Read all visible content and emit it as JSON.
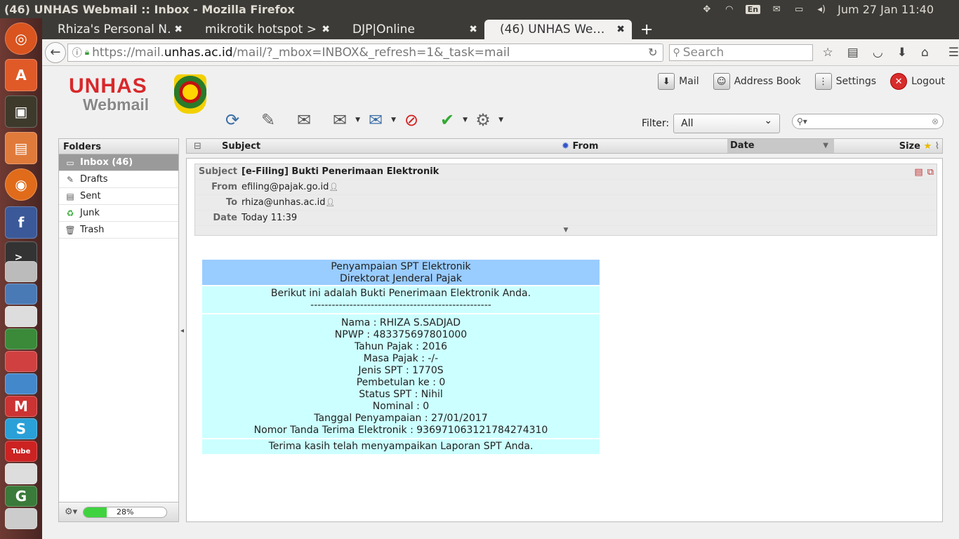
{
  "system": {
    "window_title": "(46) UNHAS Webmail :: Inbox - Mozilla Firefox",
    "keyboard_layout": "En",
    "clock": "Jum 27 Jan 11:40"
  },
  "tabs": [
    {
      "label": "Rhiza's Personal N…",
      "active": false
    },
    {
      "label": "mikrotik hotspot > …",
      "active": false
    },
    {
      "label": "DJP|Online",
      "active": false
    },
    {
      "label": "(46) UNHAS We…",
      "active": true
    }
  ],
  "browser": {
    "url_prefix": "https://mail.",
    "url_host": "unhas.ac.id",
    "url_rest": "/mail/?_mbox=INBOX&_refresh=1&_task=mail",
    "search_placeholder": "Search"
  },
  "logo": {
    "line1": "UNHAS",
    "line2": "Webmail"
  },
  "topnav": [
    {
      "label": "Mail",
      "icon": "mail-icon"
    },
    {
      "label": "Address Book",
      "icon": "address-book-icon"
    },
    {
      "label": "Settings",
      "icon": "settings-icon"
    },
    {
      "label": "Logout",
      "icon": "logout-icon"
    }
  ],
  "toolbar": [
    "refresh",
    "compose",
    "reply",
    "reply-all",
    "forward",
    "delete",
    "mark",
    "more"
  ],
  "filter": {
    "label": "Filter:",
    "value": "All"
  },
  "folders": {
    "header": "Folders",
    "items": [
      {
        "label": "Inbox (46)",
        "icon": "inbox-icon",
        "selected": true
      },
      {
        "label": "Drafts",
        "icon": "pencil-icon",
        "selected": false
      },
      {
        "label": "Sent",
        "icon": "sent-icon",
        "selected": false
      },
      {
        "label": "Junk",
        "icon": "junk-icon",
        "selected": false
      },
      {
        "label": "Trash",
        "icon": "trash-icon",
        "selected": false
      }
    ],
    "quota_text": "28%",
    "quota_value": 0.28
  },
  "list_header": {
    "subject": "Subject",
    "from": "From",
    "date": "Date",
    "size": "Size"
  },
  "message": {
    "labels": {
      "subject": "Subject",
      "from": "From",
      "to": "To",
      "date": "Date"
    },
    "subject": "[e-Filing] Bukti Penerimaan Elektronik",
    "from": "efiling@pajak.go.id",
    "to": "rhiza@unhas.ac.id",
    "date": "Today 11:39"
  },
  "body": {
    "header_line1": "Penyampaian SPT Elektronik",
    "header_line2": "Direktorat Jenderal Pajak",
    "intro": "Berikut ini adalah Bukti Penerimaan Elektronik Anda.",
    "separator": "---------------------------------------------------",
    "details": [
      "Nama : RHIZA S.SADJAD",
      "NPWP : 483375697801000",
      "Tahun Pajak : 2016",
      "Masa Pajak : -/-",
      "Jenis SPT : 1770S",
      "Pembetulan ke : 0",
      "Status SPT : Nihil",
      "Nominal : 0",
      "Tanggal Penyampaian : 27/01/2017",
      "Nomor Tanda Terima Elektronik : 936971063121784274310"
    ],
    "closing": "Terima kasih telah menyampaikan Laporan SPT Anda."
  }
}
